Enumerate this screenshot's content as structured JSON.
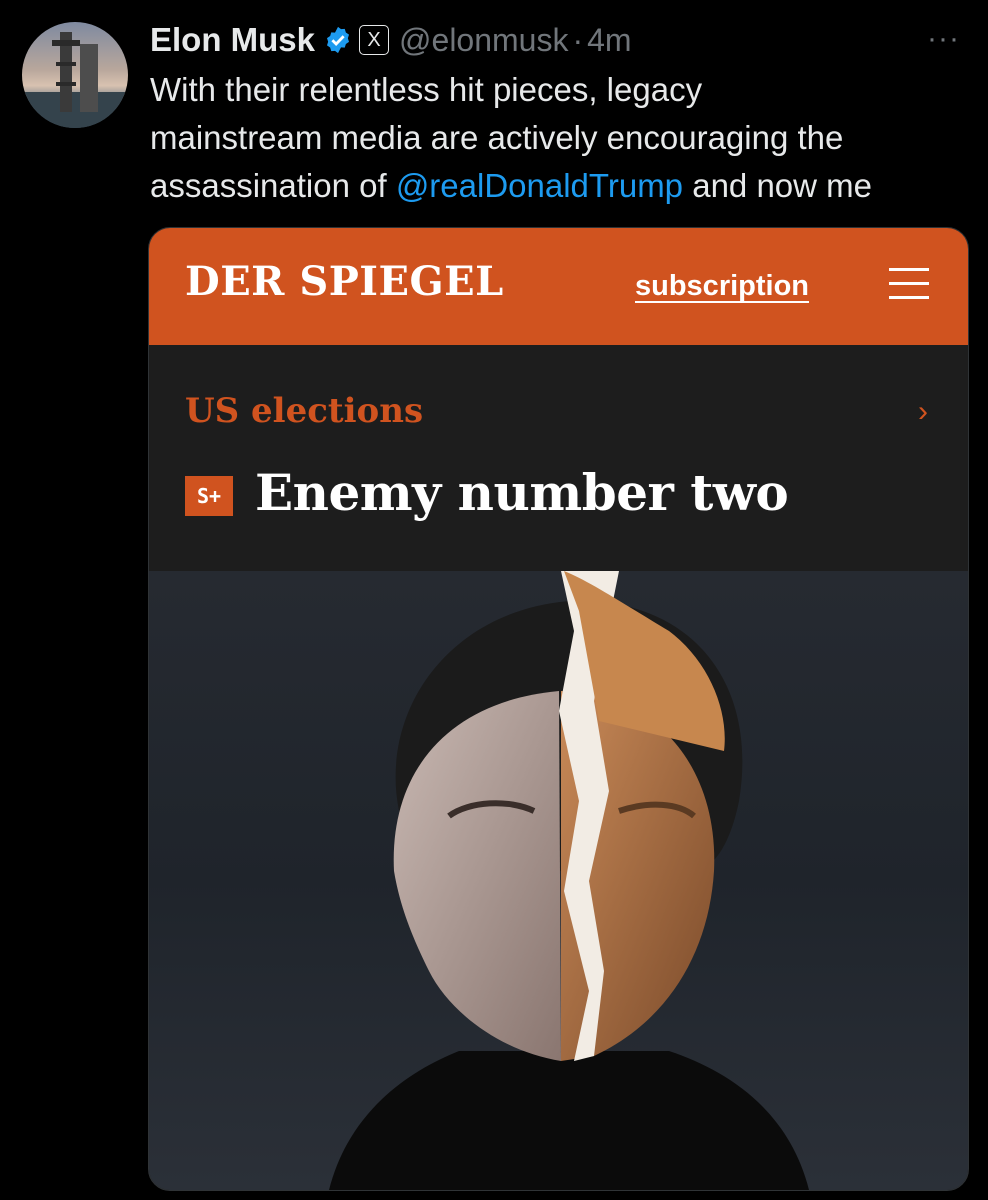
{
  "tweet": {
    "author_name": "Elon Musk",
    "handle": "@elonmusk",
    "separator": "·",
    "time": "4m",
    "x_badge": "X",
    "more": "···",
    "text_lines": [
      "With their relentless hit pieces, legacy",
      "mainstream media are actively  encouraging the"
    ],
    "line3_before": "assassination of ",
    "mention": "@realDonaldTrump",
    "line3_after": " and now me",
    "icons": [
      "avatar",
      "verified-icon",
      "x-badge-icon",
      "more-icon"
    ],
    "colors": {
      "background": "#000000",
      "text": "#e7e9ea",
      "muted": "#71767b",
      "link": "#1d9bf0",
      "verified": "#1d9bf0"
    }
  },
  "card": {
    "brand": "DER SPIEGEL",
    "subscription": "subscription",
    "category": "US elections",
    "chevron": "›",
    "badge": "S+",
    "headline": "Enemy number two",
    "icons": [
      "menu-icon",
      "chevron-right-icon",
      "photo"
    ],
    "colors": {
      "brand_orange": "#d0531f",
      "panel": "#1d1d1d"
    }
  }
}
